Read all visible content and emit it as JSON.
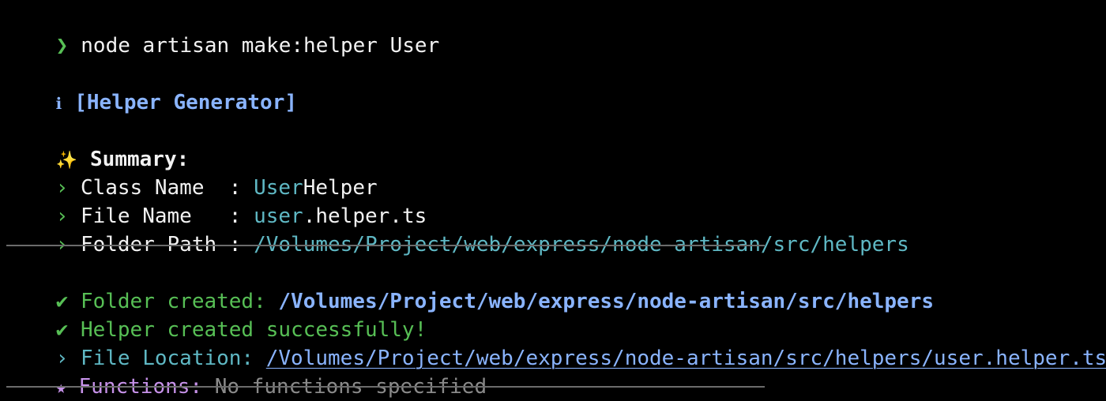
{
  "prompt": {
    "symbol": "❯",
    "command": "node artisan make:helper User"
  },
  "header": {
    "info_icon": "ℹ",
    "title": "[Helper Generator]"
  },
  "summary": {
    "sparkle_icon": "✨",
    "label": "Summary:",
    "bullet": "›",
    "rows": [
      {
        "key": "Class Name  : ",
        "value_accent": "User",
        "value_rest": "Helper"
      },
      {
        "key": "File Name   : ",
        "value_accent": "user",
        "value_rest": ".helper.ts"
      },
      {
        "key": "Folder Path : ",
        "value_accent": "/Volumes/Project/web/express/node-artisan/src/helpers",
        "value_rest": ""
      }
    ]
  },
  "results": {
    "check": "✔",
    "folder_label": "Folder created: ",
    "folder_path": "/Volumes/Project/web/express/node-artisan/src/helpers",
    "success_text": "Helper created successfully!",
    "location_bullet": "›",
    "location_label": "File Location: ",
    "location_path": "/Volumes/Project/web/express/node-artisan/src/helpers/user.helper.ts",
    "star": "★",
    "functions_label": "Functions: ",
    "functions_value": "No functions specified"
  },
  "colors": {
    "background": "#000000",
    "foreground": "#f2f2f2",
    "green": "#57bf55",
    "blue": "#8ab4ff",
    "cyan": "#5fb8c4",
    "purple": "#c792ea",
    "gray": "#8a8a8a",
    "divider": "#6b6b6b"
  }
}
